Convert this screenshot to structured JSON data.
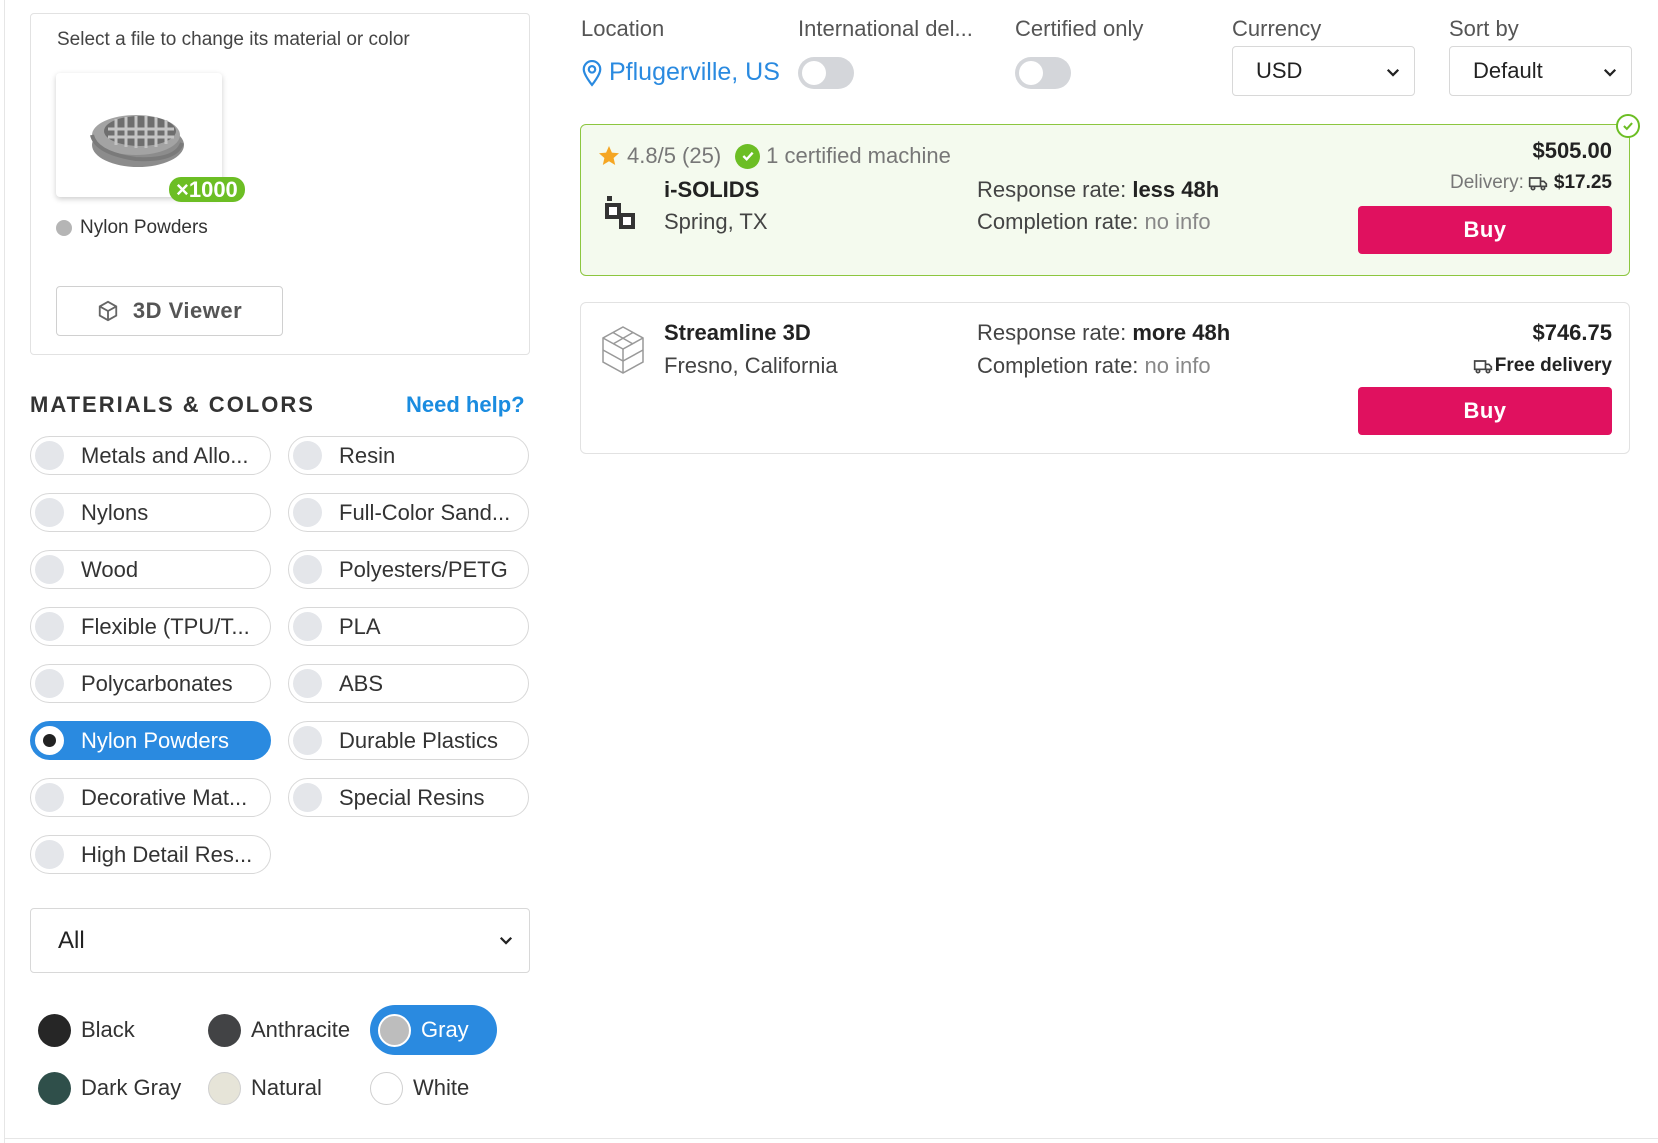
{
  "file_panel": {
    "hint": "Select a file to change its material or color",
    "quantity": "×1000",
    "material": "Nylon Powders",
    "viewer_label": "3D Viewer"
  },
  "materials": {
    "title": "MATERIALS & COLORS",
    "help_link": "Need help?",
    "items": [
      {
        "label": "Metals and Allo...",
        "selected": false
      },
      {
        "label": "Resin",
        "selected": false
      },
      {
        "label": "Nylons",
        "selected": false
      },
      {
        "label": "Full-Color Sand...",
        "selected": false
      },
      {
        "label": "Wood",
        "selected": false
      },
      {
        "label": "Polyesters/PETG",
        "selected": false
      },
      {
        "label": "Flexible (TPU/T...",
        "selected": false
      },
      {
        "label": "PLA",
        "selected": false
      },
      {
        "label": "Polycarbonates",
        "selected": false
      },
      {
        "label": "ABS",
        "selected": false
      },
      {
        "label": "Nylon Powders",
        "selected": true
      },
      {
        "label": "Durable Plastics",
        "selected": false
      },
      {
        "label": "Decorative Mat...",
        "selected": false
      },
      {
        "label": "Special Resins",
        "selected": false
      },
      {
        "label": "High Detail Res...",
        "selected": false
      }
    ],
    "subtype_value": "All"
  },
  "colors": {
    "items": [
      {
        "label": "Black",
        "hex": "#262626",
        "selected": false
      },
      {
        "label": "Anthracite",
        "hex": "#424345",
        "selected": false
      },
      {
        "label": "Gray",
        "hex": "#bdbdbd",
        "selected": true
      },
      {
        "label": "Dark Gray",
        "hex": "#2f4f4a",
        "selected": false
      },
      {
        "label": "Natural",
        "hex": "#e6e4d8",
        "selected": false
      },
      {
        "label": "White",
        "hex": "#ffffff",
        "selected": false
      }
    ]
  },
  "filters": {
    "location_label": "Location",
    "location_value": "Pflugerville, US",
    "intl_label": "International del...",
    "intl_on": false,
    "certified_label": "Certified only",
    "certified_on": false,
    "currency_label": "Currency",
    "currency_value": "USD",
    "sort_label": "Sort by",
    "sort_value": "Default"
  },
  "offers": [
    {
      "rating": "4.8/5 (25)",
      "certified": "1 certified machine",
      "name": "i-SOLIDS",
      "location": "Spring, TX",
      "response_label": "Response rate:",
      "response_value": "less 48h",
      "completion_label": "Completion rate:",
      "completion_value": "no info",
      "price": "$505.00",
      "delivery_label": "Delivery:",
      "delivery_value": "$17.25",
      "buy_label": "Buy"
    },
    {
      "name": "Streamline 3D",
      "location": "Fresno, California",
      "response_label": "Response rate:",
      "response_value": "more 48h",
      "completion_label": "Completion rate:",
      "completion_value": "no info",
      "price": "$746.75",
      "delivery_value": "Free delivery",
      "buy_label": "Buy"
    }
  ],
  "accent_colors": {
    "blue": "#2a8ae0",
    "buy": "#e0115f",
    "green": "#6cbe24"
  }
}
